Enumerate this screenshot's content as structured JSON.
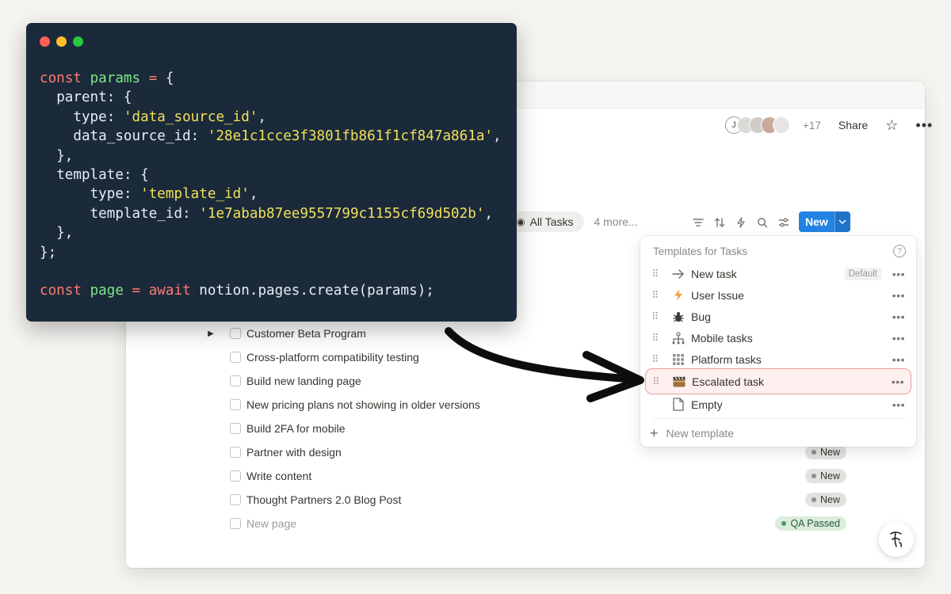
{
  "header": {
    "avatar_initial": "J",
    "collaborator_count": "+17",
    "share_label": "Share",
    "star_icon": "star-icon",
    "more_icon": "more-horizontal-icon"
  },
  "views": {
    "active_tab": "All Tasks",
    "more_views": "4 more..."
  },
  "toolbar": {
    "icons": [
      "filter-icon",
      "sort-icon",
      "automation-icon",
      "search-icon",
      "settings-icon"
    ],
    "new_label": "New"
  },
  "tasks": [
    {
      "label": "Customer Beta Program",
      "expandable": true,
      "status": ""
    },
    {
      "label": "Cross-platform compatibility testing",
      "expandable": false,
      "status": ""
    },
    {
      "label": "Build new landing page",
      "expandable": false,
      "status": ""
    },
    {
      "label": "New pricing plans not showing in older versions",
      "expandable": false,
      "status": ""
    },
    {
      "label": "Build 2FA for mobile",
      "expandable": false,
      "status": ""
    },
    {
      "label": "Partner with design",
      "expandable": false,
      "status": "New"
    },
    {
      "label": "Write content",
      "expandable": false,
      "status": "New"
    },
    {
      "label": "Thought Partners 2.0 Blog Post",
      "expandable": false,
      "status": "New"
    },
    {
      "label": "New page",
      "expandable": false,
      "status": "QA Passed",
      "muted": true
    }
  ],
  "templates_menu": {
    "title": "Templates for Tasks",
    "items": [
      {
        "label": "New task",
        "icon": "arrow-right-icon",
        "tag": "Default"
      },
      {
        "label": "User Issue",
        "icon": "lightning-icon",
        "tag": ""
      },
      {
        "label": "Bug",
        "icon": "bug-icon",
        "tag": ""
      },
      {
        "label": "Mobile tasks",
        "icon": "hierarchy-icon",
        "tag": ""
      },
      {
        "label": "Platform tasks",
        "icon": "grid-icon",
        "tag": ""
      },
      {
        "label": "Escalated task",
        "icon": "clapperboard-icon",
        "tag": ""
      },
      {
        "label": "Empty",
        "icon": "page-icon",
        "tag": ""
      }
    ],
    "new_template_label": "New template"
  },
  "code_window": {
    "lines": [
      "const params = {",
      "  parent: {",
      "    type: 'data_source_id',",
      "    data_source_id: '28e1c1cce3f3801fb861f1cf847a861a',",
      "  },",
      "  template: {",
      "      type: 'template_id',",
      "      template_id: '1e7abab87ee9557799c1155cf69d502b',",
      "  },",
      "};",
      "",
      "const page = await notion.pages.create(params);"
    ]
  },
  "colors": {
    "accent_blue": "#2383e2",
    "code_bg": "#1b2a3a",
    "highlight_border": "#e99d98",
    "qa_green": "#4e9a63"
  }
}
